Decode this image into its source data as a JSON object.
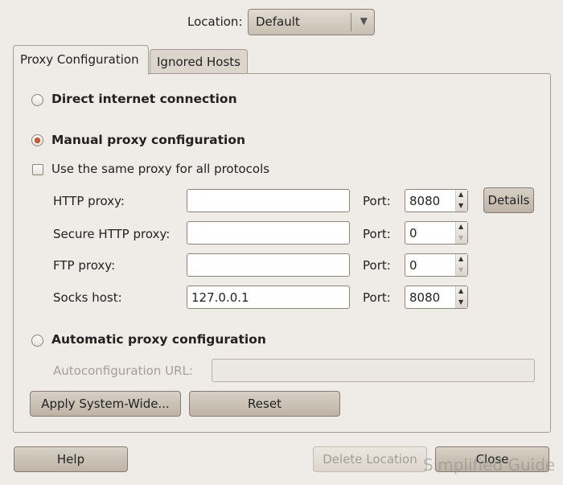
{
  "location": {
    "label": "Location:",
    "value": "Default"
  },
  "tabs": [
    {
      "label": "Proxy Configuration",
      "active": true
    },
    {
      "label": "Ignored Hosts",
      "active": false
    }
  ],
  "proxy": {
    "direct_label": "Direct internet connection",
    "manual_label": "Manual proxy configuration",
    "same_proxy_label": "Use the same proxy for all protocols",
    "selected_mode": "manual",
    "port_label": "Port:",
    "rows": [
      {
        "label": "HTTP proxy:",
        "host": "",
        "port": "8080"
      },
      {
        "label": "Secure HTTP proxy:",
        "host": "",
        "port": "0"
      },
      {
        "label": "FTP proxy:",
        "host": "",
        "port": "0"
      },
      {
        "label": "Socks host:",
        "host": "127.0.0.1",
        "port": "8080"
      }
    ],
    "details_button": "Details",
    "automatic_label": "Automatic proxy configuration",
    "autoconfig_label": "Autoconfiguration URL:",
    "autoconfig_value": ""
  },
  "buttons": {
    "apply_system_wide": "Apply System-Wide...",
    "reset": "Reset",
    "help": "Help",
    "delete_location": "Delete Location",
    "close": "Close"
  },
  "watermark": "Simplified Guide",
  "icons": {
    "combo_arrow": "triangle-down-icon",
    "spin_up": "triangle-up-icon",
    "spin_down": "triangle-down-icon"
  },
  "colors": {
    "window_bg": "#efebe7",
    "radio_selected": "#d6622c",
    "button_bg": "#c9c0b3"
  }
}
